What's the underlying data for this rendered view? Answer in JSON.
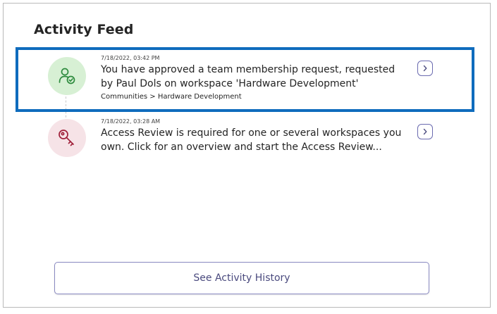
{
  "feed": {
    "title": "Activity Feed",
    "items": [
      {
        "timestamp": "7/18/2022, 03:42 PM",
        "message_line1": "You have approved a team membership request, requested",
        "message_line2": "by Paul Dols on workspace 'Hardware Development'",
        "breadcrumb": "Communities > Hardware Development",
        "icon": "person-check-icon",
        "icon_color": "#2e8b3e",
        "icon_bg": "#d7f0d4"
      },
      {
        "timestamp": "7/18/2022, 03:28 AM",
        "message_line1": "Access Review is required for one or several workspaces you",
        "message_line2": "own. Click for an overview and start the Access Review...",
        "icon": "key-icon",
        "icon_color": "#a0203a",
        "icon_bg": "#f6e3e7"
      }
    ],
    "selected_border_color": "#0f6cbd",
    "history_button_label": "See Activity History"
  }
}
